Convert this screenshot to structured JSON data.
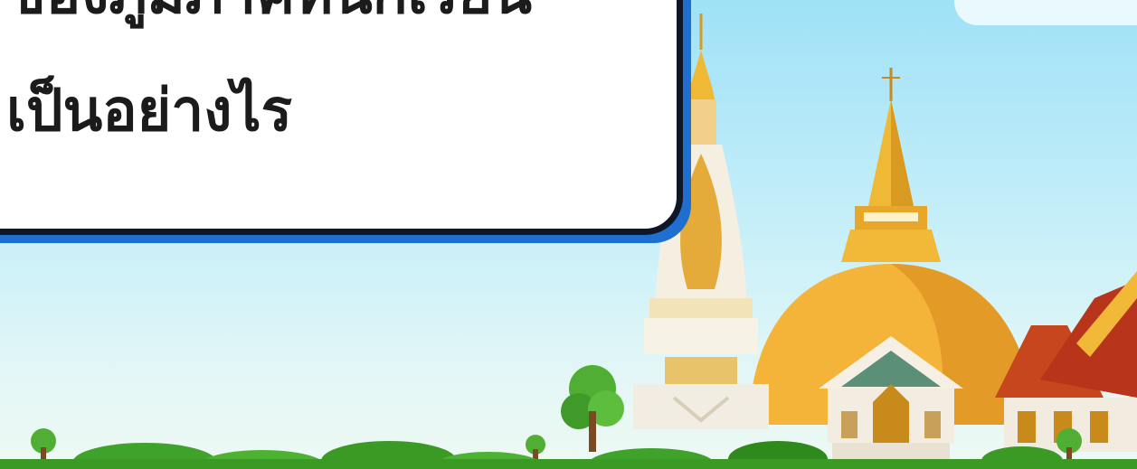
{
  "card": {
    "line1": "ของภูมิภาคที่นักเรียน",
    "line2": "เป็นอย่างไร"
  },
  "colors": {
    "sky_top": "#9fe1f7",
    "card_border": "#0f1626",
    "card_shadow": "#1f6fd1",
    "stupa_gold": "#e9a72a",
    "grass": "#3a9a24"
  },
  "icons": [
    "lotus-stupa-icon",
    "golden-chedi-icon",
    "thai-temple-icon",
    "tree-icon",
    "grass-icon"
  ]
}
